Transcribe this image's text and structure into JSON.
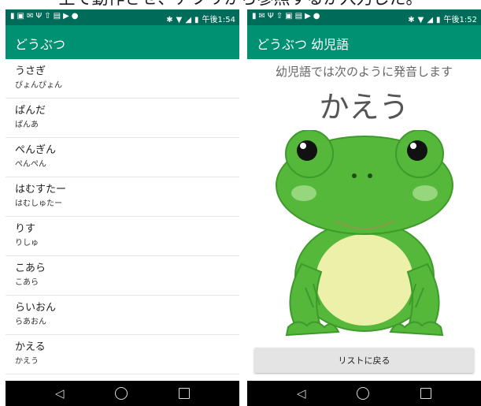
{
  "caption": "上で動作させ、アプリから参照するか入力した。",
  "status_bar": {
    "left_icons": [
      "notification-icon",
      "image-icon",
      "mail-icon",
      "usb-icon",
      "upload-icon",
      "media-icon",
      "play-store-icon",
      "location-icon"
    ],
    "right_icons": [
      "bluetooth-icon",
      "wifi-icon",
      "signal-icon",
      "battery-icon"
    ]
  },
  "left_screen": {
    "status_time": "午後1:54",
    "app_title": "どうぶつ",
    "items": [
      {
        "name": "うさぎ",
        "baby_word": "ぴょんぴょん"
      },
      {
        "name": "ぱんだ",
        "baby_word": "ぱんあ"
      },
      {
        "name": "ぺんぎん",
        "baby_word": "ぺんぺん"
      },
      {
        "name": "はむすたー",
        "baby_word": "はむしゅたー"
      },
      {
        "name": "りす",
        "baby_word": "りしゅ"
      },
      {
        "name": "こあら",
        "baby_word": "こあら"
      },
      {
        "name": "らいおん",
        "baby_word": "らあおん"
      },
      {
        "name": "かえる",
        "baby_word": "かえう"
      }
    ]
  },
  "right_screen": {
    "status_time": "午後1:52",
    "app_title": "どうぶつ 幼児語",
    "instruction": "幼児語では次のように発音します",
    "word": "かえう",
    "illustration": "frog",
    "back_button": "リストに戻る"
  },
  "navigation": {
    "back_icon": "◁",
    "home_icon": "home-circle-icon",
    "recents_icon": "recents-square-icon"
  },
  "colors": {
    "status_bar": "#006b59",
    "app_bar": "#009072",
    "nav_bar": "#000000",
    "frog_green": "#55b83a",
    "frog_belly": "#ecf0a8"
  }
}
